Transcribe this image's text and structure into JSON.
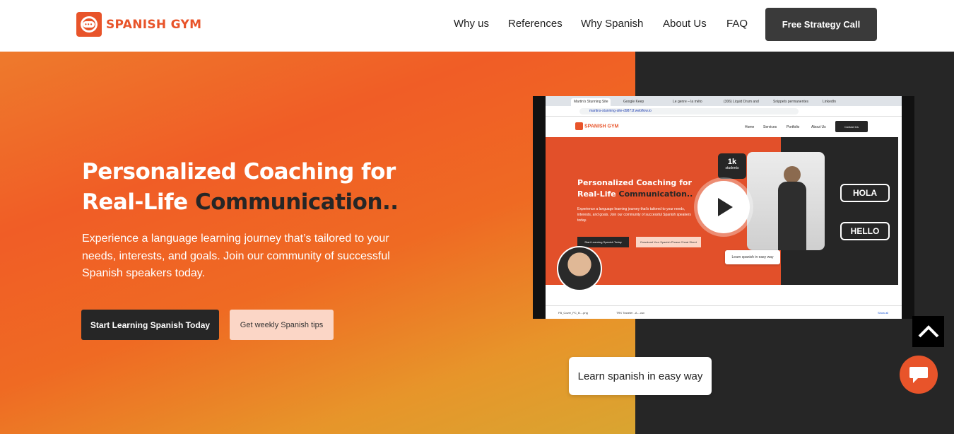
{
  "header": {
    "logo_text": "SPANISH GYM",
    "nav": [
      "Why us",
      "References",
      "Why Spanish",
      "About Us",
      "FAQ"
    ],
    "cta": "Free Strategy Call"
  },
  "hero": {
    "title_line1": "Personalized Coaching for",
    "title_line2_prefix": "Real-Life ",
    "title_line2_dark": "Communication..",
    "subtitle": "Experience a language learning journey that’s tailored to your needs, interests, and goals. Join our community of successful Spanish speakers today.",
    "primary_button": "Start Learning Spanish Today",
    "secondary_button": "Get weekly Spanish tips"
  },
  "video": {
    "tabs": [
      "Martin's Stunning Site",
      "Google Keep",
      "Le genre – la méto",
      "(306) Liquid Drum and",
      "Snippets permanentes",
      "LinkedIn"
    ],
    "url": "martins-stunning-site-d9871f.webflow.io",
    "site_logo": "SPANISH GYM",
    "site_links": [
      "Home",
      "Services",
      "Portfolio",
      "About Us"
    ],
    "site_cta": "Contact Us",
    "site_title_line1": "Personalized Coaching for",
    "site_title_line2_prefix": "Real-Life ",
    "site_title_line2_dark": "Communication..",
    "site_subtitle": "Experience a language learning journey that's tailored to your needs, interests, and goals. Join our community of successful Spanish speakers today.",
    "site_btn1": "Start Learning Spanish Today",
    "site_btn2": "Download Your Spanish Phrase Cheat Sheet",
    "badge_number": "1k",
    "badge_label": "students",
    "chip": "Learn spanish in easy way",
    "hola": "HOLA",
    "hello": "HELLO",
    "downloads": [
      "FB_Cover_PC_B....png",
      "TRX Traveler - A....csv"
    ],
    "show_all": "Show all"
  },
  "tooltip": "Learn spanish in easy way",
  "colors": {
    "brand": "#e8542a",
    "dark": "#262626"
  }
}
